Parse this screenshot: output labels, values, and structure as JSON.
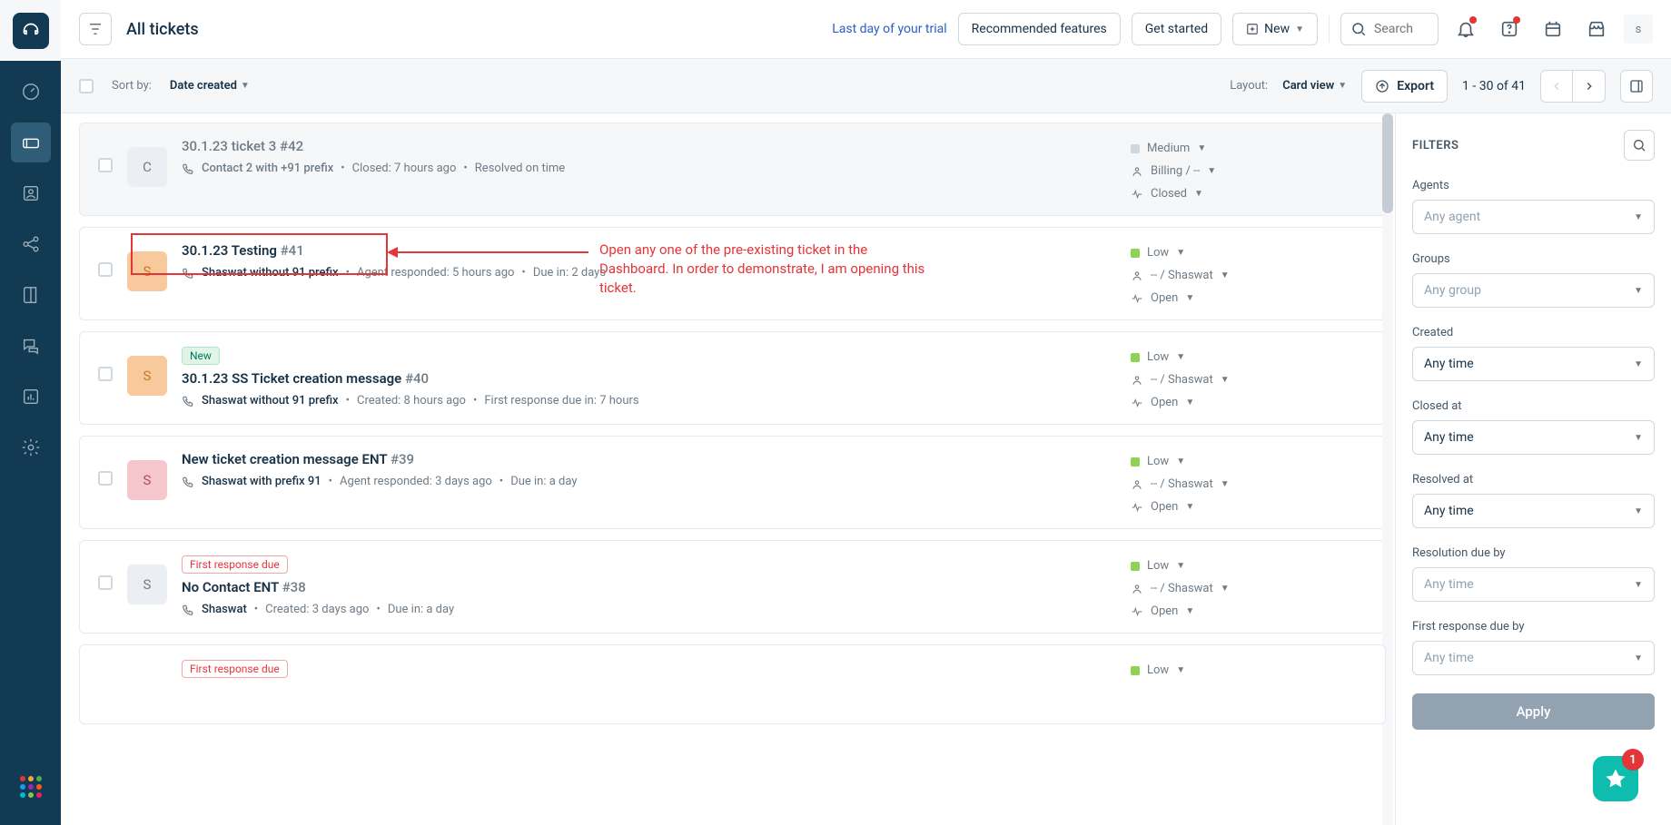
{
  "header": {
    "title": "All tickets",
    "trial_text": "Last day of your trial",
    "recommended_btn": "Recommended features",
    "get_started_btn": "Get started",
    "new_btn": "New",
    "search_placeholder": "Search",
    "avatar": "s"
  },
  "toolbar": {
    "sort_label": "Sort by:",
    "sort_value": "Date created",
    "layout_label": "Layout:",
    "layout_value": "Card view",
    "export_btn": "Export",
    "page_info": "1 - 30 of 41"
  },
  "annotation": {
    "text": "Open any one of the pre-existing ticket in the Dashboard. In order to demonstrate, I am opening this ticket."
  },
  "tickets": [
    {
      "avatar": "C",
      "av_class": "av-grey",
      "closed": true,
      "title": "30.1.23 ticket 3",
      "id": "#42",
      "contact": "Contact 2 with +91 prefix",
      "meta1": "Closed: 7 hours ago",
      "meta2": "Resolved on time",
      "priority": "Medium",
      "pri_class": "pri-grey",
      "group": "Billing / --",
      "status": "Closed",
      "badge": null
    },
    {
      "avatar": "S",
      "av_class": "av-orange",
      "closed": false,
      "title": "30.1.23 Testing",
      "id": "#41",
      "contact": "Shaswat without 91 prefix",
      "meta1": "Agent responded: 5 hours ago",
      "meta2": "Due in: 2 days",
      "priority": "Low",
      "pri_class": "pri-green",
      "group": "-- / Shaswat",
      "status": "Open",
      "badge": null,
      "highlighted": true
    },
    {
      "avatar": "S",
      "av_class": "av-orange",
      "closed": false,
      "title": "30.1.23 SS Ticket creation message",
      "id": "#40",
      "contact": "Shaswat without 91 prefix",
      "meta1": "Created: 8 hours ago",
      "meta2": "First response due in: 7 hours",
      "priority": "Low",
      "pri_class": "pri-green",
      "group": "-- / Shaswat",
      "status": "Open",
      "badge": "New",
      "badge_class": "badge-new"
    },
    {
      "avatar": "S",
      "av_class": "av-pink",
      "closed": false,
      "title": "New ticket creation message ENT",
      "id": "#39",
      "contact": "Shaswat with prefix 91",
      "meta1": "Agent responded: 3 days ago",
      "meta2": "Due in: a day",
      "priority": "Low",
      "pri_class": "pri-green",
      "group": "-- / Shaswat",
      "status": "Open",
      "badge": null
    },
    {
      "avatar": "S",
      "av_class": "av-grey",
      "closed": false,
      "title": "No Contact ENT",
      "id": "#38",
      "contact": "Shaswat",
      "meta1": "Created: 3 days ago",
      "meta2": "Due in: a day",
      "priority": "Low",
      "pri_class": "pri-green",
      "group": "-- / Shaswat",
      "status": "Open",
      "badge": "First response due",
      "badge_class": "badge-due"
    },
    {
      "avatar": "",
      "av_class": "",
      "closed": false,
      "title": "",
      "id": "",
      "contact": "",
      "meta1": "",
      "meta2": "",
      "priority": "Low",
      "pri_class": "pri-green",
      "group": "",
      "status": "",
      "badge": "First response due",
      "badge_class": "badge-due",
      "partial": true
    }
  ],
  "filters": {
    "title": "FILTERS",
    "agents_label": "Agents",
    "agents_value": "Any agent",
    "agents_ph": true,
    "groups_label": "Groups",
    "groups_value": "Any group",
    "groups_ph": true,
    "created_label": "Created",
    "created_value": "Any time",
    "created_ph": false,
    "closed_label": "Closed at",
    "closed_value": "Any time",
    "closed_ph": false,
    "resolved_label": "Resolved at",
    "resolved_value": "Any time",
    "resolved_ph": false,
    "res_due_label": "Resolution due by",
    "res_due_value": "Any time",
    "res_due_ph": true,
    "first_label": "First response due by",
    "first_value": "Any time",
    "first_ph": true,
    "apply_btn": "Apply"
  },
  "fab": {
    "badge": "1"
  }
}
